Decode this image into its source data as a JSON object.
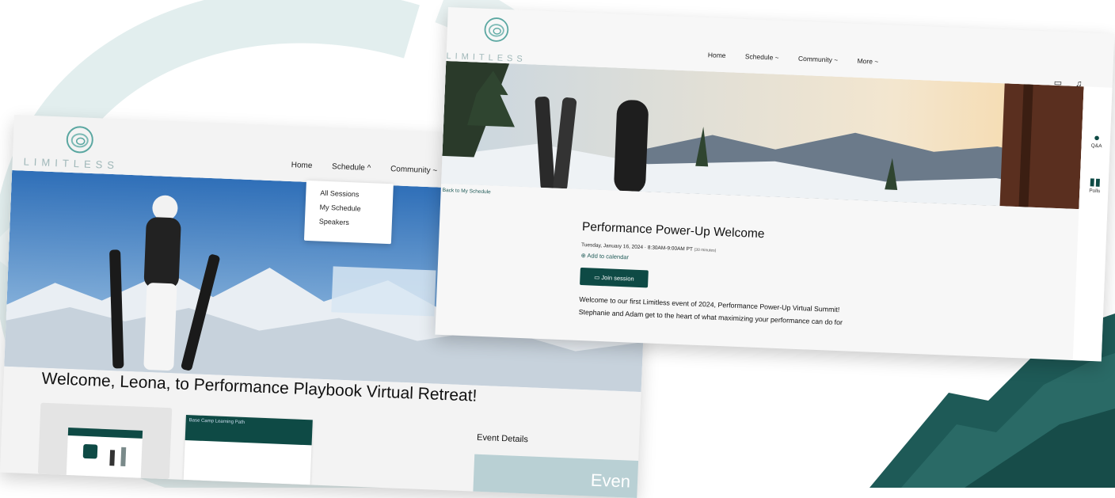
{
  "back_screen": {
    "logo_text": "LIMITLESS",
    "nav": {
      "home": "Home",
      "schedule": "Schedule ^",
      "community": "Community ~"
    },
    "dropdown": [
      "All Sessions",
      "My Schedule",
      "Speakers"
    ],
    "welcome_heading": "Welcome, Leona, to Performance Playbook Virtual Retreat!",
    "card_header": "Base Camp Learning Path",
    "event_details_label": "Event Details",
    "event_thumb_text": "Even"
  },
  "front_screen": {
    "logo_text": "LIMITLESS",
    "nav": {
      "home": "Home",
      "schedule": "Schedule ~",
      "community": "Community ~",
      "more": "More ~"
    },
    "icons": [
      "calendar-icon",
      "bell-icon",
      "avatar"
    ],
    "rail": {
      "qa": "Q&A",
      "polls": "Polls"
    },
    "back_link": "Back to My Schedule",
    "title": "Performance Power-Up Welcome",
    "datetime": "Tuesday, January 16, 2024 · 8:30AM-9:00AM PT",
    "duration": "(30 minutes)",
    "add_to_calendar": "⊕ Add to calendar",
    "join_button": "▭ Join session",
    "description_line1": "Welcome to our first Limitless event of 2024, Performance Power-Up Virtual Summit!",
    "description_line2": "Stephanie and Adam get to the heart of what maximizing your performance can do for"
  },
  "colors": {
    "accent": "#0e4a45",
    "logo": "#9fb7b8",
    "swirl": "#e2eeee"
  }
}
